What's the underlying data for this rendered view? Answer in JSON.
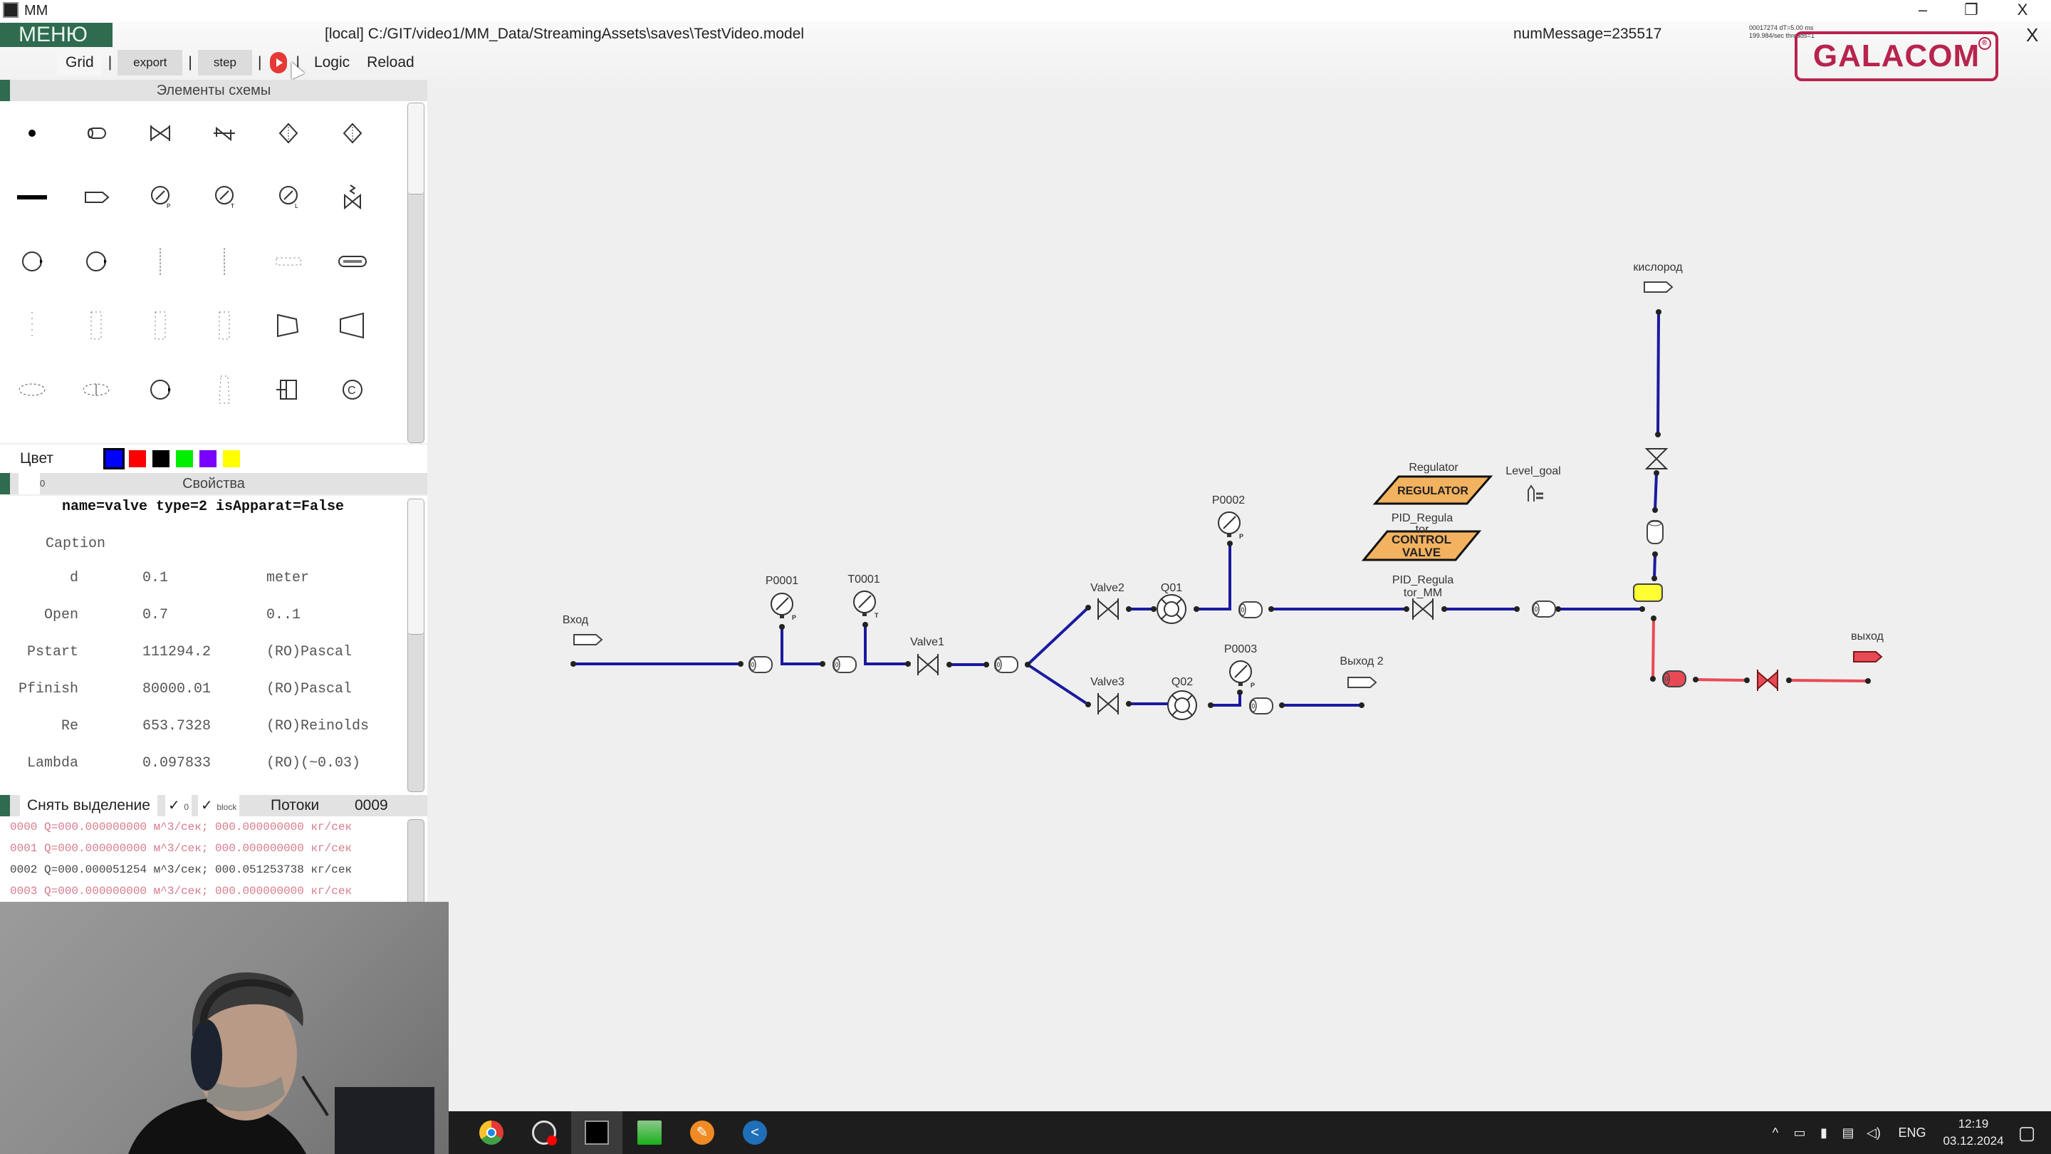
{
  "window": {
    "title": "MM",
    "controls": {
      "minimize": "–",
      "restore": "❐",
      "close": "X"
    }
  },
  "header": {
    "menu_label": "МЕНЮ",
    "file_path": "[local] C:/GIT/video1/MM_Data/StreamingAssets\\saves\\TestVideo.model",
    "num_message": "numMessage=235517",
    "stats_line1": "00017274 dT=5.00 ms",
    "stats_line2": "199.984/sec threads=1",
    "logo_text": "GALACOM",
    "logo_sign": "®",
    "close_label": "X"
  },
  "toolbar": {
    "grid": "Grid",
    "export": "export",
    "step": "step",
    "separator": "|",
    "logic": "Logic",
    "reload": "Reload"
  },
  "palette": {
    "title": "Элементы схемы",
    "items": [
      "node-dot",
      "pipe-segment",
      "valve",
      "check-valve",
      "filter",
      "filter-alt",
      "thick-line",
      "inlet-outlet",
      "pressure-gauge",
      "temperature-gauge",
      "level-gauge",
      "control-valve",
      "pump",
      "pump-alt",
      "vertical-column",
      "vertical-column-alt",
      "heater",
      "heat-exchanger",
      "column-dashed",
      "reactor-dashed",
      "reactor-alt",
      "reactor-dashed-alt",
      "compressor",
      "turbine",
      "separator-dashed",
      "separator-dashed-alt",
      "fan",
      "tower-dashed",
      "mixer",
      "compressor-c"
    ]
  },
  "colors": {
    "label": "Цвет",
    "swatches": [
      "#0000ff",
      "#ff0000",
      "#000000",
      "#00ee00",
      "#7a00ff",
      "#ffff00"
    ],
    "selected": "#0000ff"
  },
  "properties": {
    "title": "Свойства",
    "index": "0",
    "header": "name=valve type=2 isApparat=False",
    "caption_label": "Caption",
    "rows": [
      {
        "name": "d",
        "value": "0.1",
        "unit": "meter"
      },
      {
        "name": "Open",
        "value": "0.7",
        "unit": "0..1"
      },
      {
        "name": "Pstart",
        "value": "111294.2",
        "unit": "(RO)Pascal"
      },
      {
        "name": "Pfinish",
        "value": "80000.01",
        "unit": "(RO)Pascal"
      },
      {
        "name": "Re",
        "value": "653.7328",
        "unit": "(RO)Reinolds"
      },
      {
        "name": "Lambda",
        "value": "0.097833",
        "unit": "(RO)(~0.03)"
      }
    ]
  },
  "flows": {
    "clear_selection": "Снять выделение",
    "check1_label": "0",
    "check2_label": "block",
    "check_mark": "✓",
    "title": "Потоки",
    "count": "0009",
    "lines": [
      {
        "text": "0000 Q=000.000000000 м^3/сек; 000.000000000 кг/сек",
        "state": "zero"
      },
      {
        "text": "0001 Q=000.000000000 м^3/сек; 000.000000000 кг/сек",
        "state": "zero"
      },
      {
        "text": "0002 Q=000.000051254 м^3/сек; 000.051253738 кг/сек",
        "state": "active"
      },
      {
        "text": "0003 Q=000.000000000 м^3/сек; 000.000000000 кг/сек",
        "state": "zero"
      }
    ]
  },
  "diagram": {
    "pipe_color_active": "#1a1aa0",
    "pipe_color_red": "#e84a55",
    "labels": {
      "inlet": "Вход",
      "p0001": "P0001",
      "t0001": "T0001",
      "valve1": "Valve1",
      "valve2": "Valve2",
      "valve3": "Valve3",
      "q01": "Q01",
      "q02": "Q02",
      "p0002": "P0002",
      "p0003": "P0003",
      "outlet2": "Выход 2",
      "regulator": "Regulator",
      "regulator_box": "REGULATOR",
      "level_goal": "Level_goal",
      "pid1_a": "PID_Regula",
      "pid1_b": "tor",
      "control_valve_1": "CONTROL",
      "control_valve_2": "VALVE",
      "pid_mm_a": "PID_Regula",
      "pid_mm_b": "tor_MM",
      "oxygen": "кислород",
      "outlet": "выход"
    }
  },
  "taskbar": {
    "apps": [
      "chrome",
      "obs-studio",
      "mm-app",
      "green-app",
      "pencil-app",
      "share-app"
    ],
    "tray_lang": "ENG",
    "time": "12:19",
    "date": "03.12.2024"
  }
}
